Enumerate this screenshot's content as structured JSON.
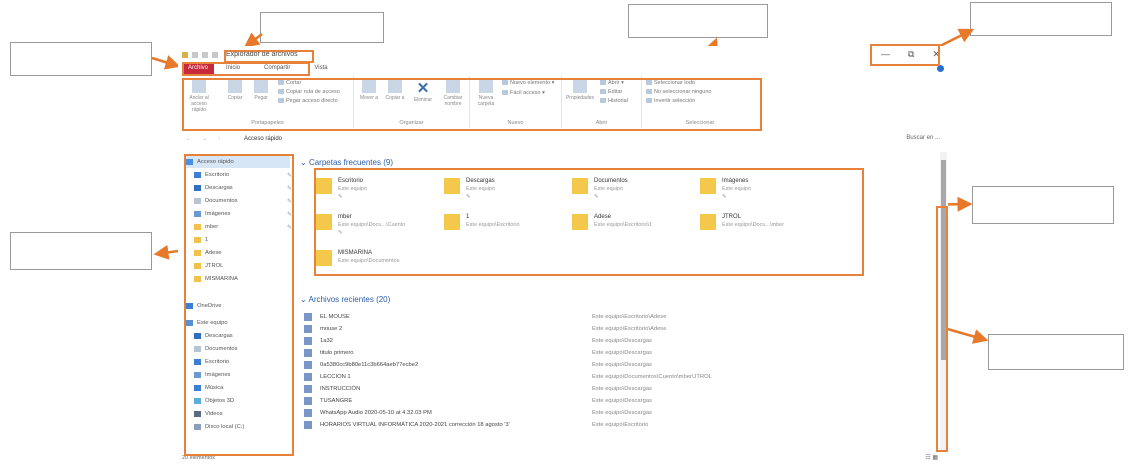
{
  "window": {
    "title": "Explorador de archivos",
    "controls": {
      "minimize": "—",
      "maximize": "⧉",
      "close": "✕"
    }
  },
  "tabs": [
    "Archivo",
    "Inicio",
    "Compartir",
    "Vista"
  ],
  "ribbon": {
    "portapapeles": {
      "name": "Portapapeles",
      "anclar": "Anclar al acceso rápido",
      "copiar": "Copiar",
      "pegar": "Pegar",
      "cortar": "Cortar",
      "copiar_ruta": "Copiar ruta de acceso",
      "pegar_acceso": "Pegar acceso directo"
    },
    "organizar": {
      "name": "Organizar",
      "mover": "Mover a",
      "copiar_a": "Copiar a",
      "eliminar": "Eliminar",
      "cambiar_nombre": "Cambiar nombre"
    },
    "nuevo": {
      "name": "Nuevo",
      "nueva_carpeta": "Nueva carpeta",
      "nuevo_elemento": "Nuevo elemento",
      "facil_acceso": "Fácil acceso"
    },
    "abrir": {
      "name": "Abrir",
      "propiedades": "Propiedades",
      "abrir": "Abrir",
      "editar": "Editar",
      "historial": "Historial"
    },
    "seleccionar": {
      "name": "Seleccionar",
      "todo": "Seleccionar todo",
      "ninguno": "No seleccionar ninguno",
      "invertir": "Invertir selección"
    }
  },
  "address": {
    "nav": "← → ↑",
    "crumb": "Acceso rápido",
    "search_placeholder": "Buscar en ..."
  },
  "nav_items": [
    {
      "label": "Acceso rápido",
      "color": "#4a8fe0",
      "pin": ""
    },
    {
      "label": "Escritorio",
      "color": "#3b7fd4",
      "pin": "✎"
    },
    {
      "label": "Descargas",
      "color": "#2f6fc0",
      "pin": "✎"
    },
    {
      "label": "Documentos",
      "color": "#b8c4d0",
      "pin": "✎"
    },
    {
      "label": "Imágenes",
      "color": "#6a9ad0",
      "pin": "✎"
    },
    {
      "label": "mber",
      "color": "#f0c24a",
      "pin": "✎"
    },
    {
      "label": "1",
      "color": "#f0c24a",
      "pin": ""
    },
    {
      "label": "Adese",
      "color": "#f0c24a",
      "pin": ""
    },
    {
      "label": "JTROL",
      "color": "#f0c24a",
      "pin": ""
    },
    {
      "label": "MISMARINA",
      "color": "#f0c24a",
      "pin": ""
    },
    {
      "label": "OneDrive",
      "color": "#3b7fd4",
      "pin": ""
    },
    {
      "label": "Este equipo",
      "color": "#5a8fd0",
      "pin": ""
    },
    {
      "label": "Descargas",
      "color": "#2f6fc0",
      "pin": ""
    },
    {
      "label": "Documentos",
      "color": "#b8c4d0",
      "pin": ""
    },
    {
      "label": "Escritorio",
      "color": "#3b7fd4",
      "pin": ""
    },
    {
      "label": "Imágenes",
      "color": "#6a9ad0",
      "pin": ""
    },
    {
      "label": "Música",
      "color": "#3b7fd4",
      "pin": ""
    },
    {
      "label": "Objetos 3D",
      "color": "#5aaed8",
      "pin": ""
    },
    {
      "label": "Videos",
      "color": "#5a6a80",
      "pin": ""
    },
    {
      "label": "Disco local (C:)",
      "color": "#8aa0b8",
      "pin": ""
    }
  ],
  "frequent": {
    "header": "Carpetas frecuentes (9)",
    "items": [
      {
        "name": "Escritorio",
        "path": "Este equipo",
        "pin": "✎"
      },
      {
        "name": "Descargas",
        "path": "Este equipo",
        "pin": "✎"
      },
      {
        "name": "Documentos",
        "path": "Este equipo",
        "pin": "✎"
      },
      {
        "name": "Imágenes",
        "path": "Este equipo",
        "pin": "✎"
      },
      {
        "name": "mber",
        "path": "Este equipo\\Docu...\\Cuento",
        "pin": "✎"
      },
      {
        "name": "1",
        "path": "Este equipo\\Escritorio",
        "pin": ""
      },
      {
        "name": "Adese",
        "path": "Este equipo\\Escritorio\\1",
        "pin": ""
      },
      {
        "name": "JTROL",
        "path": "Este equipo\\Docu...\\mber",
        "pin": ""
      },
      {
        "name": "MISMARINA",
        "path": "Este equipo\\Documentos",
        "pin": ""
      }
    ]
  },
  "recent": {
    "header": "Archivos recientes (20)",
    "items": [
      {
        "name": "EL MOUSE",
        "path": "Este equipo\\Escritorio\\Adese"
      },
      {
        "name": "mouse 2",
        "path": "Este equipo\\Escritorio\\Adese"
      },
      {
        "name": "1a32",
        "path": "Este equipo\\Descargas"
      },
      {
        "name": "titulo primero",
        "path": "Este equipo\\Descargas"
      },
      {
        "name": "0a5380cc9b80e11c3b664aeb77ecbe2",
        "path": "Este equipo\\Descargas"
      },
      {
        "name": "LECCION 1",
        "path": "Este equipo\\Documentos\\Cuento\\mber\\JTROL"
      },
      {
        "name": "INSTRUCCIÓN",
        "path": "Este equipo\\Descargas"
      },
      {
        "name": "TUSANGRE",
        "path": "Este equipo\\Descargas"
      },
      {
        "name": "WhatsApp Audio 2020-05-10 at 4.32.03 PM",
        "path": "Este equipo\\Descargas"
      },
      {
        "name": "HORARIOS VIRTUAL INFORMÁTICA 2020-2021 corrección 18 agosto '3'",
        "path": "Este equipo\\Escritorio"
      }
    ]
  },
  "status": "20 elementos",
  "colors": {
    "accent": "#c8283b",
    "highlight": "#e8823a",
    "link": "#2a5ea8"
  }
}
